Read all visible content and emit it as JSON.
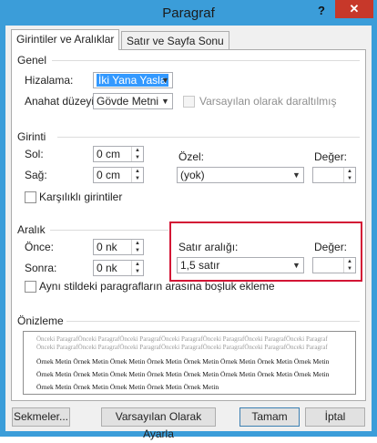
{
  "title": "Paragraf",
  "help_glyph": "?",
  "close_glyph": "✕",
  "tabs": [
    {
      "label": "Girintiler ve Aralıklar"
    },
    {
      "label": "Satır ve Sayfa Sonu"
    }
  ],
  "genel": {
    "title": "Genel",
    "hizalama_label": "Hizalama:",
    "hizalama_value": "İki Yana Yasla",
    "anahat_label": "Anahat düzeyi:",
    "anahat_value": "Gövde Metni",
    "daraltilmis_label": "Varsayılan olarak daraltılmış"
  },
  "girinti": {
    "title": "Girinti",
    "sol_label": "Sol:",
    "sol_value": "0 cm",
    "sag_label": "Sağ:",
    "sag_value": "0 cm",
    "ozel_label": "Özel:",
    "ozel_value": "(yok)",
    "deger_label": "Değer:",
    "deger_value": "",
    "karsilikli_label": "Karşılıklı girintiler"
  },
  "aralik": {
    "title": "Aralık",
    "once_label": "Önce:",
    "once_value": "0 nk",
    "sonra_label": "Sonra:",
    "sonra_value": "0 nk",
    "satir_label": "Satır aralığı:",
    "satir_value": "1,5 satır",
    "deger_label": "Değer:",
    "deger_value": "",
    "ayni_stil_label": "Aynı stildeki paragrafların arasına boşluk ekleme"
  },
  "onizleme": {
    "title": "Önizleme",
    "prev_lines": [
      "Önceki ParagrafÖnceki ParagrafÖnceki ParagrafÖnceki ParagrafÖnceki ParagrafÖnceki ParagrafÖnceki Paragraf",
      "Önceki ParagrafÖnceki ParagrafÖnceki ParagrafÖnceki ParagrafÖnceki ParagrafÖnceki ParagrafÖnceki Paragraf"
    ],
    "sample_lines": [
      "Örnek Metin Örnek Metin Örnek Metin Örnek Metin Örnek Metin Örnek Metin Örnek Metin Örnek Metin",
      "Örnek Metin Örnek Metin Örnek Metin Örnek Metin Örnek Metin Örnek Metin Örnek Metin Örnek Metin",
      "Örnek Metin Örnek Metin Örnek Metin Örnek Metin Örnek Metin"
    ]
  },
  "buttons": {
    "sekmeler": "Sekmeler...",
    "varsayilan": "Varsayılan Olarak Ayarla",
    "tamam": "Tamam",
    "iptal": "İptal"
  },
  "colors": {
    "frame": "#3b9dd9",
    "close": "#c7382a",
    "highlight": "#d31535",
    "selection": "#3399ff"
  }
}
